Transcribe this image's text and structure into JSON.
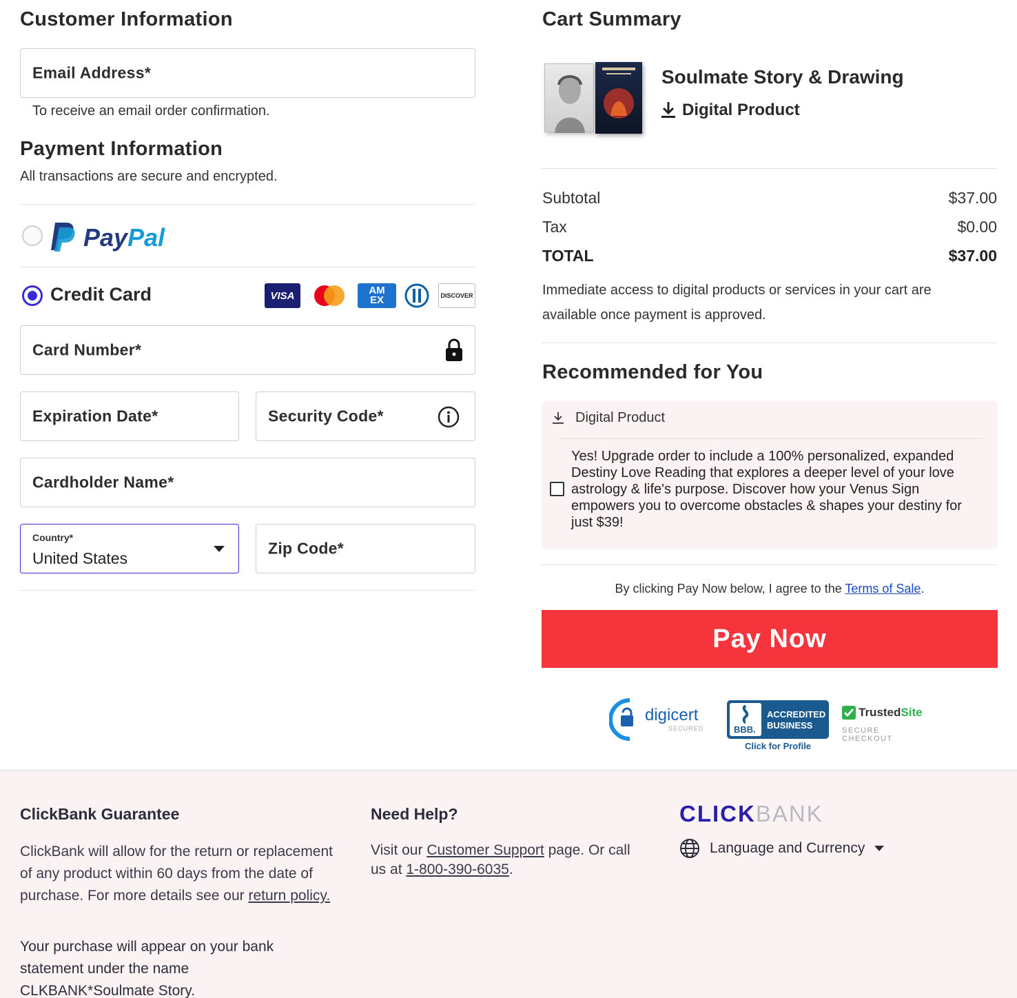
{
  "customer": {
    "heading": "Customer Information",
    "email_label": "Email Address*",
    "email_hint": "To receive an email order confirmation."
  },
  "payment": {
    "heading": "Payment Information",
    "subtext": "All transactions are secure and encrypted.",
    "paypal_label": "PayPal",
    "paypal_pay": "Pay",
    "paypal_pal": "Pal",
    "credit_card_label": "Credit Card",
    "card_logos": [
      "VISA",
      "AM EX",
      "DISCOVER"
    ],
    "card_number_label": "Card Number*",
    "expiration_label": "Expiration Date*",
    "security_label": "Security Code*",
    "cardholder_label": "Cardholder Name*",
    "country_label": "Country*",
    "country_value": "United States",
    "zip_label": "Zip Code*",
    "selected_method": "Credit Card"
  },
  "cart": {
    "heading": "Cart Summary",
    "product_title": "Soulmate Story & Drawing",
    "product_type": "Digital Product",
    "subtotal_label": "Subtotal",
    "subtotal_value": "$37.00",
    "tax_label": "Tax",
    "tax_value": "$0.00",
    "total_label": "TOTAL",
    "total_value": "$37.00",
    "access_note": "Immediate access to digital products or services in your cart are available once payment is approved."
  },
  "recommended": {
    "heading": "Recommended for You",
    "type": "Digital Product",
    "offer_text": "Yes! Upgrade order to include a 100% personalized, expanded Destiny Love Reading that explores a deeper level of your love astrology & life's purpose. Discover how your Venus Sign empowers you to overcome obstacles & shapes your destiny for just $39!",
    "checked": false
  },
  "terms": {
    "prefix": "By clicking Pay Now below, I agree to the ",
    "link": "Terms of Sale",
    "suffix": "."
  },
  "pay_button": "Pay Now",
  "badges": {
    "digicert": "digicert",
    "digicert_sub": "SECURED",
    "bbb_line1": "ACCREDITED",
    "bbb_line2": "BUSINESS",
    "bbb_mark": "BBB.",
    "bbb_link": "Click for Profile",
    "trusted_a": "Trusted",
    "trusted_b": "Site",
    "trusted_sub": "SECURE CHECKOUT"
  },
  "footer": {
    "guarantee_heading": "ClickBank Guarantee",
    "guarantee_text": "ClickBank will allow for the return or replacement of any product within 60 days from the date of purchase. For more details see our ",
    "guarantee_link": "return policy.",
    "statement_text": "Your purchase will appear on your bank statement under the name CLKBANK*Soulmate Story.",
    "help_heading": "Need Help?",
    "help_prefix": "Visit our ",
    "help_link": "Customer Support",
    "help_mid": " page. Or call us at ",
    "help_phone": "1-800-390-6035",
    "help_suffix": ".",
    "brand_a": "CLICK",
    "brand_b": "BANK",
    "language_label": "Language and Currency"
  },
  "colors": {
    "accent": "#3b2bd6",
    "pay_button": "#f5343b",
    "footer_bg": "#fbf3f3",
    "link_blue": "#1d49c9"
  }
}
